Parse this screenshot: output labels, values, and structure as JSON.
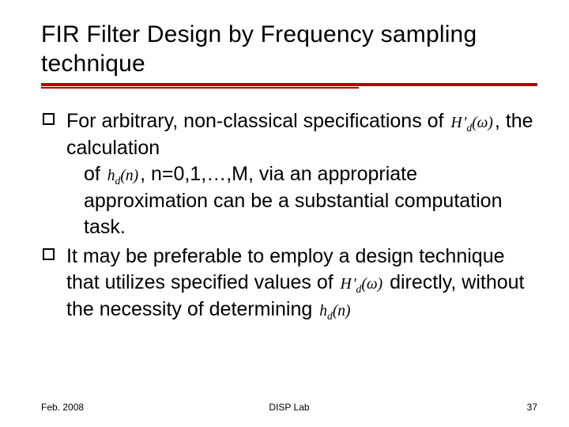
{
  "title": "FIR Filter Design by Frequency sampling technique",
  "bullets": [
    {
      "seg1": "For arbitrary, non-classical specifications of ",
      "math1": "H'_d(ω)",
      "seg2": ", the calculation",
      "cont_seg1": "of ",
      "cont_math": "h_d(n)",
      "cont_seg2": ", n=0,1,…,M, via an appropriate approximation can be a substantial computation task."
    },
    {
      "seg1": "It may be preferable to employ a design technique that utilizes specified values of ",
      "math1": "H'_d(ω)",
      "seg2": " directly, without the necessity of determining ",
      "math2": "h_d(n)"
    }
  ],
  "footer": {
    "left": "Feb. 2008",
    "center": "DISP Lab",
    "right": "37"
  },
  "math_render": {
    "H'_d(ω)": "H&#8202;'<sub>d</sub>(&#969;)",
    "h_d(n)": "h<sub>d</sub>(n)"
  }
}
